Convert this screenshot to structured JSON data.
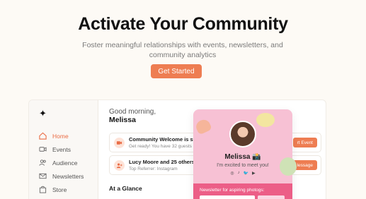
{
  "hero": {
    "title": "Activate Your Community",
    "subtitle": "Foster meaningful relationships with events, newsletters, and community analytics",
    "cta": "Get Started"
  },
  "sidebar": {
    "items": [
      {
        "label": "Home",
        "icon": "home-icon",
        "active": true
      },
      {
        "label": "Events",
        "icon": "video-icon",
        "active": false
      },
      {
        "label": "Audience",
        "icon": "users-icon",
        "active": false
      },
      {
        "label": "Newsletters",
        "icon": "mail-icon",
        "active": false
      },
      {
        "label": "Store",
        "icon": "bag-icon",
        "active": false
      }
    ]
  },
  "main": {
    "greeting": "Good morning,",
    "name": "Melissa",
    "cards": [
      {
        "title": "Community Welcome is starti",
        "subtitle": "Get ready! You have 32 guests",
        "button": "rt Event",
        "icon": "video-icon"
      },
      {
        "title": "Lucy Moore and 25 others sub",
        "subtitle": "Top Referrer: Instagram",
        "button": "lessage",
        "icon": "user-plus-icon"
      }
    ],
    "section_title": "At a Glance"
  },
  "profile": {
    "name": "Melissa 📸",
    "bio": "I'm excited to meet you!",
    "socials": [
      "◎",
      "♪",
      "🐦",
      "▶"
    ],
    "newsletter_label": "Newsletter for aspiring photogs:"
  },
  "colors": {
    "accent": "#ee7d52",
    "card_pink": "#f7c1d4",
    "newsletter_pink": "#ec5e87",
    "background": "#fdfaf5"
  }
}
